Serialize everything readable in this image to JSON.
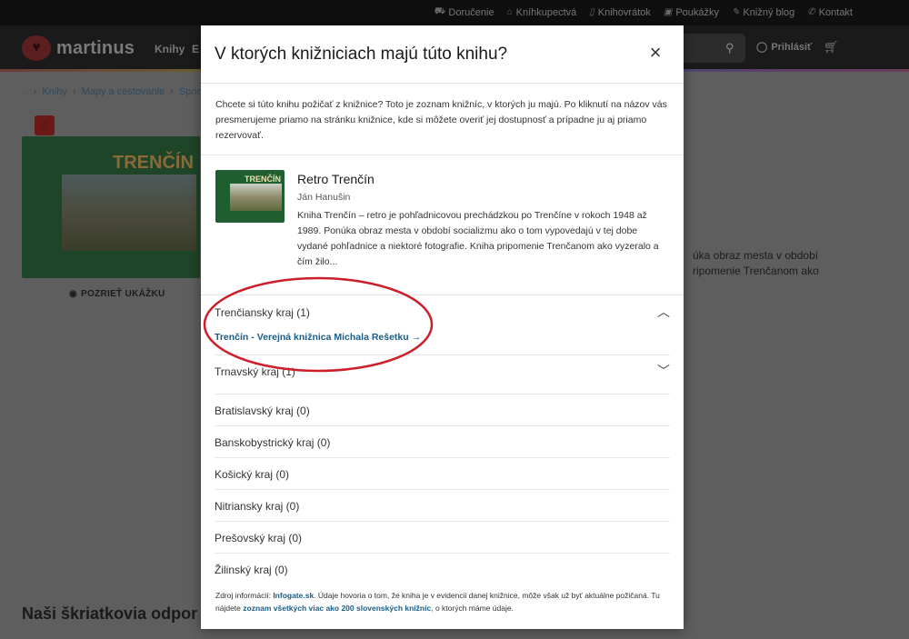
{
  "top_links": [
    {
      "icon": "truck-icon",
      "glyph": "⛟",
      "label": "Doručenie"
    },
    {
      "icon": "store-icon",
      "glyph": "⌂",
      "label": "Kníhkupectvá"
    },
    {
      "icon": "book-return-icon",
      "glyph": "▯",
      "label": "Knihovrátok"
    },
    {
      "icon": "gift-icon",
      "glyph": "▣",
      "label": "Poukážky"
    },
    {
      "icon": "pen-icon",
      "glyph": "✎",
      "label": "Knižný blog"
    },
    {
      "icon": "phone-icon",
      "glyph": "✆",
      "label": "Kontakt"
    }
  ],
  "header": {
    "logo_text": "martinus",
    "nav_books": "Knihy",
    "nav_e": "E",
    "login": "Prihlásiť"
  },
  "breadcrumb": [
    "Knihy",
    "Mapy a cestovanie",
    "Sprie"
  ],
  "background": {
    "cover_title": "TRENČÍN",
    "preview": "POZRIEŤ UKÁŽKU",
    "desc_line1": "úka obraz mesta v období",
    "desc_line2": "ripomenie Trenčanom ako",
    "heading": "Naši škriatkovia odpor"
  },
  "modal": {
    "title": "V ktorých knižniciach majú túto knihu?",
    "intro": "Chcete si túto knihu požičať z knižnice? Toto je zoznam knižníc, v ktorých ju majú. Po kliknutí na názov vás presmerujeme priamo na stránku knižnice, kde si môžete overiť jej dostupnosť a prípadne ju aj priamo rezervovať.",
    "book": {
      "cover_text": "TRENČÍN",
      "title": "Retro Trenčín",
      "author": "Ján Hanušin",
      "description": "Kniha Trenčín – retro je pohľadnicovou prechádzkou po Trenčíne v rokoch 1948 až 1989. Ponúka obraz mesta v období socializmu ako o tom vypovedajú v tej dobe vydané pohľadnice a niektoré fotografie. Kniha pripomenie Trenčanom ako vyzeralo a čím žilo..."
    },
    "regions": [
      {
        "label": "Trenčiansky kraj (1)",
        "state": "open",
        "library": {
          "city": "Trenčín -",
          "name": "Verejná knižnica Michala Rešetku"
        }
      },
      {
        "label": "Trnavský kraj (1)",
        "state": "closed"
      },
      {
        "label": "Bratislavský kraj (0)"
      },
      {
        "label": "Banskobystrický kraj (0)"
      },
      {
        "label": "Košický kraj (0)"
      },
      {
        "label": "Nitriansky kraj (0)"
      },
      {
        "label": "Prešovský kraj (0)"
      },
      {
        "label": "Žilinský kraj (0)"
      }
    ],
    "source": {
      "prefix": "Zdroj informácií:",
      "source_link": "Infogate.sk",
      "middle": ". Údaje hovoria o tom, že kniha je v evidencii danej knižnice, môže však už byť aktuálne požičaná. Tu nájdete",
      "list_link": "zoznam všetkých viac ako 200 slovenských knižníc",
      "suffix": ", o ktorých máme údaje."
    }
  },
  "colors": {
    "accent_link": "#1b5c86",
    "annotation_red": "#cc1f2a",
    "overlay": "#5e5e5e"
  }
}
